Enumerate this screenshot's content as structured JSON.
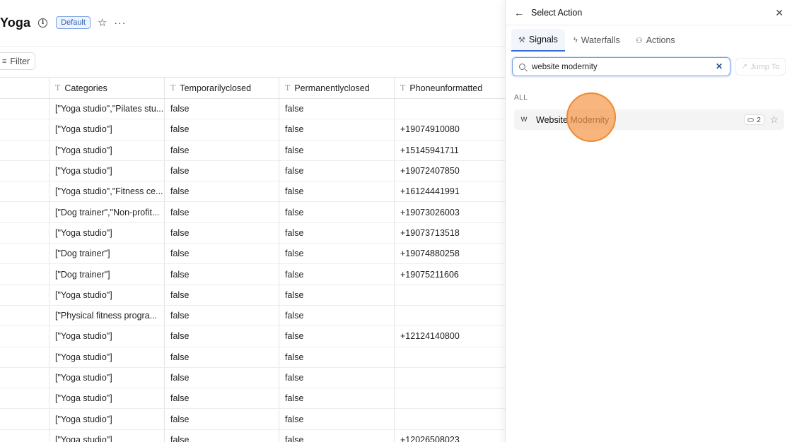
{
  "page": {
    "title": "Yoga",
    "badge": "Default",
    "filter_label": "Filter"
  },
  "table": {
    "columns": [
      "Categories",
      "Temporarilyclosed",
      "Permanentlyclosed",
      "Phoneunformatted"
    ],
    "rows": [
      [
        "[\"Yoga studio\",\"Pilates stu...",
        "false",
        "false",
        ""
      ],
      [
        "[\"Yoga studio\"]",
        "false",
        "false",
        "+19074910080"
      ],
      [
        "[\"Yoga studio\"]",
        "false",
        "false",
        "+15145941711"
      ],
      [
        "[\"Yoga studio\"]",
        "false",
        "false",
        "+19072407850"
      ],
      [
        "[\"Yoga studio\",\"Fitness ce...",
        "false",
        "false",
        "+16124441991"
      ],
      [
        "[\"Dog trainer\",\"Non-profit...",
        "false",
        "false",
        "+19073026003"
      ],
      [
        "[\"Yoga studio\"]",
        "false",
        "false",
        "+19073713518"
      ],
      [
        "[\"Dog trainer\"]",
        "false",
        "false",
        "+19074880258"
      ],
      [
        "[\"Dog trainer\"]",
        "false",
        "false",
        "+19075211606"
      ],
      [
        "[\"Yoga studio\"]",
        "false",
        "false",
        ""
      ],
      [
        "[\"Physical fitness progra...",
        "false",
        "false",
        ""
      ],
      [
        "[\"Yoga studio\"]",
        "false",
        "false",
        "+12124140800"
      ],
      [
        "[\"Yoga studio\"]",
        "false",
        "false",
        ""
      ],
      [
        "[\"Yoga studio\"]",
        "false",
        "false",
        ""
      ],
      [
        "[\"Yoga studio\"]",
        "false",
        "false",
        ""
      ],
      [
        "[\"Yoga studio\"]",
        "false",
        "false",
        ""
      ],
      [
        "[\"Yoga studio\"]",
        "false",
        "false",
        "+12026508023"
      ]
    ]
  },
  "panel": {
    "title": "Select Action",
    "tabs": [
      {
        "label": "Signals",
        "icon": "signals-icon",
        "active": true
      },
      {
        "label": "Waterfalls",
        "icon": "lightning-icon",
        "active": false
      },
      {
        "label": "Actions",
        "icon": "actions-icon",
        "active": false
      }
    ],
    "search": {
      "value": "website modernity",
      "placeholder": "Search"
    },
    "jump_label": "Jump To",
    "section_label": "ALL",
    "results": [
      {
        "avatar": "W",
        "label": "Website Modernity",
        "credits": "2"
      }
    ]
  },
  "colors": {
    "accent": "#3b6fd4",
    "click_indicator": "#f7984c"
  }
}
